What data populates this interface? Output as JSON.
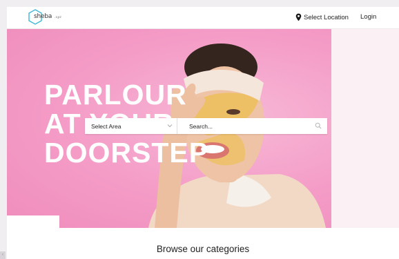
{
  "nav": {
    "logo_text": "sheba",
    "logo_tagline": ".xyz",
    "select_location": "Select Location",
    "login": "Login"
  },
  "hero": {
    "heading_lines": [
      "PARLOUR",
      "AT YOUR",
      "DOORSTEP"
    ]
  },
  "search": {
    "area_label": "Select Area",
    "placeholder": "Search..."
  },
  "categories": {
    "title": "Browse our categories"
  },
  "icons": [
    "logo-hexagon-icon",
    "location-pin-icon",
    "chevron-down-icon",
    "search-icon"
  ],
  "colors": {
    "hero_background": "#f59ac6",
    "brand_accent": "#3bb7d8",
    "text_dark": "#222222"
  }
}
